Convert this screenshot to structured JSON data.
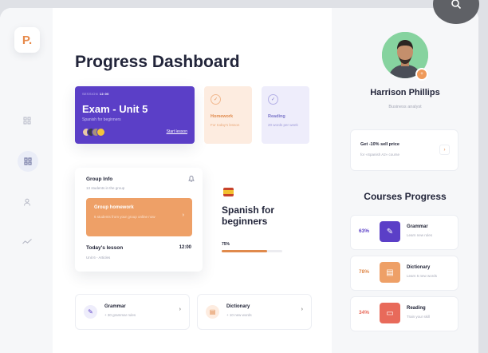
{
  "sidebar": {
    "logo": "P.",
    "nav_icons": [
      "grid-icon",
      "dashboard-icon",
      "user-icon",
      "chart-icon"
    ]
  },
  "main": {
    "title": "Progress Dashboard",
    "exam_card": {
      "session_label": "SESSION",
      "time": "12:00",
      "title": "Exam - Unit 5",
      "subtitle": "Spanish for beginners",
      "link": "Start lesson",
      "color": "#5b3fc7"
    },
    "mini_cards": [
      {
        "label": "Homework",
        "sub": "For today's lesson",
        "color": "#fdece0",
        "text_color": "#e08a4c"
      },
      {
        "label": "Reading",
        "sub": "20 words per week",
        "color": "#eeedfb",
        "text_color": "#7b76c9"
      }
    ],
    "group_info": {
      "title": "Group Info",
      "subtitle": "13 students in the group",
      "homework_title": "Group homework",
      "homework_text": "6 students from your group online now",
      "lesson_label": "Today's lesson",
      "lesson_time": "12:00",
      "lesson_sub": "Unit 6 - Articles"
    },
    "course": {
      "title": "Spanish for beginners",
      "progress_label": "75%",
      "progress": 0.75
    },
    "bottom_cards": [
      {
        "title": "Grammar",
        "sub": "+ 30 grammar rules",
        "icon": "pencil-icon"
      },
      {
        "title": "Dictionary",
        "sub": "+ 10 new words",
        "icon": "book-icon"
      }
    ]
  },
  "profile": {
    "name": "Harrison Phillips",
    "role": "Business analyst"
  },
  "promo": {
    "title": "Get -10% sell price",
    "sub": "for «Spanish A2» course"
  },
  "courses_progress": {
    "title": "Courses Progress",
    "items": [
      {
        "percent": "63%",
        "name": "Grammar",
        "sub": "Learn new rules",
        "color": "#5b3fc7"
      },
      {
        "percent": "78%",
        "name": "Dictionary",
        "sub": "Learn 5 new words",
        "color": "#eea067"
      },
      {
        "percent": "34%",
        "name": "Reading",
        "sub": "Train your skill",
        "color": "#e86a5a"
      }
    ]
  },
  "accent": "#e08a4c"
}
